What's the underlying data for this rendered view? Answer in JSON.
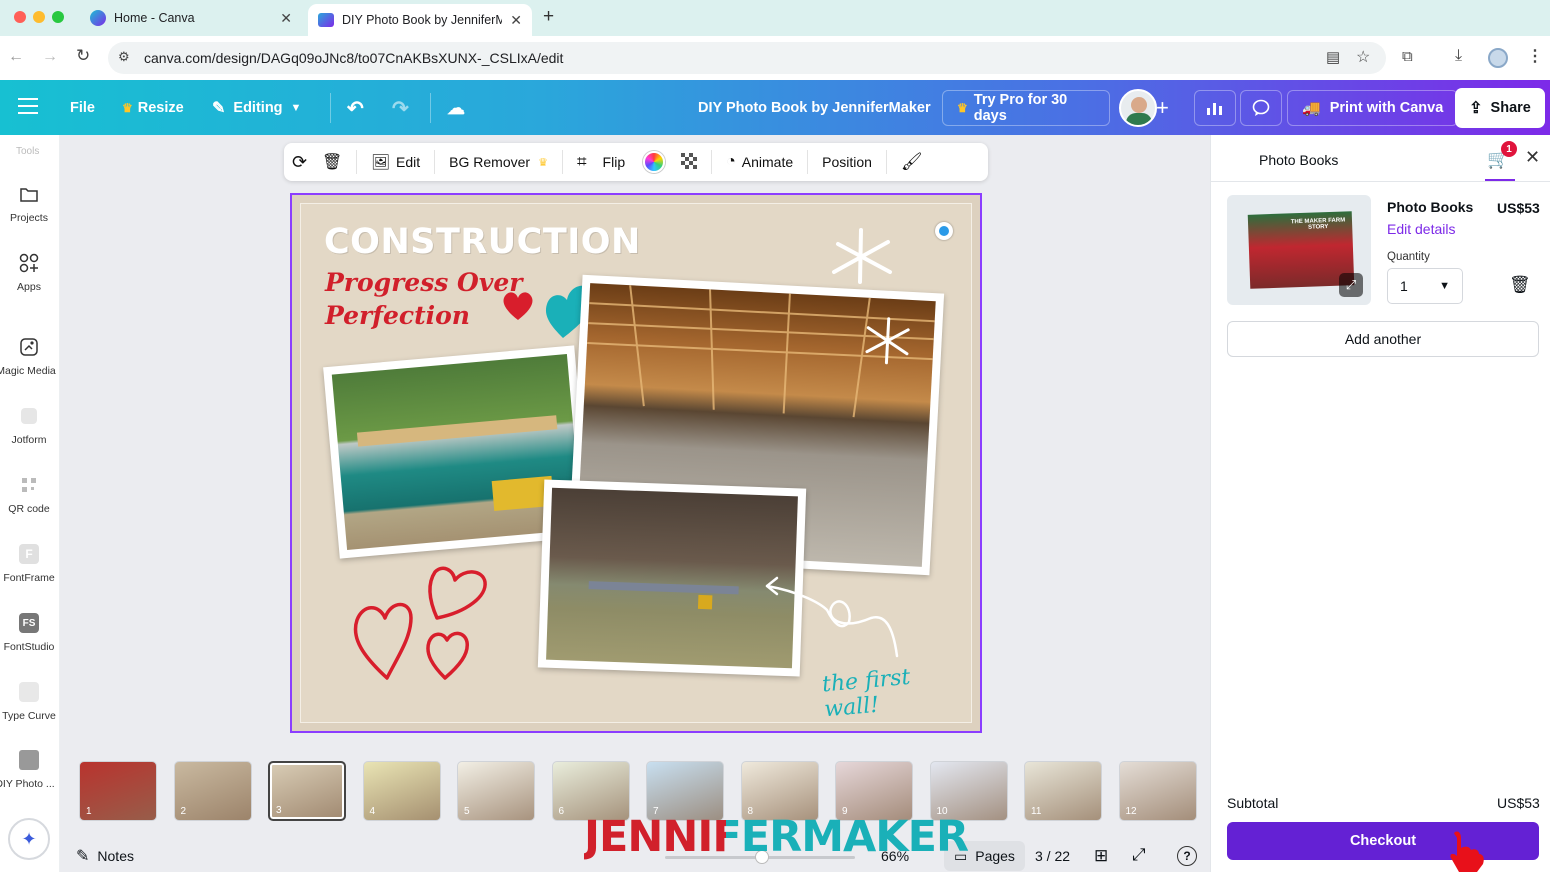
{
  "browser": {
    "tabs": [
      {
        "title": "Home - Canva"
      },
      {
        "title": "DIY Photo Book by JenniferM"
      }
    ],
    "new_tab_icon": "plus-icon",
    "url": "canva.com/design/DAGq09oJNc8/to07CnAKBsXUNX-_CSLIxA/edit"
  },
  "header": {
    "menu_icon": "hamburger-icon",
    "file_label": "File",
    "resize_label": "Resize",
    "editing_label": "Editing",
    "design_title": "DIY Photo Book by JenniferMaker",
    "try_pro_label": "Try Pro for 30 days",
    "print_label": "Print with Canva",
    "share_label": "Share"
  },
  "sidebar": {
    "partial_label": "Tools",
    "items": [
      {
        "label": "Projects",
        "icon": "folder-icon"
      },
      {
        "label": "Apps",
        "icon": "apps-grid-icon"
      },
      {
        "label": "Magic Media",
        "icon": "magic-media-icon"
      },
      {
        "label": "Jotform",
        "icon": "jotform-icon"
      },
      {
        "label": "QR code",
        "icon": "qr-code-icon"
      },
      {
        "label": "FontFrame",
        "icon": "fontframe-icon"
      },
      {
        "label": "FontStudio",
        "icon": "fontstudio-icon"
      },
      {
        "label": "Type Curve",
        "icon": "type-curve-icon"
      },
      {
        "label": "DIY Photo ...",
        "icon": "photo-app-icon"
      }
    ]
  },
  "toolbar": {
    "edit_label": "Edit",
    "bg_remover_label": "BG Remover",
    "flip_label": "Flip",
    "animate_label": "Animate",
    "position_label": "Position"
  },
  "canvas": {
    "title": "CONSTRUCTION",
    "subtitle_line1": "Progress Over",
    "subtitle_line2": "Perfection",
    "caption": "the first wall!"
  },
  "thumbnails": {
    "pages": [
      "1",
      "2",
      "3",
      "4",
      "5",
      "6",
      "7",
      "8",
      "9",
      "10",
      "11",
      "12"
    ],
    "active_page": "3",
    "colors": [
      "#b9332e",
      "#c9b9a0",
      "#d9cdb6",
      "#e9e4b4",
      "#f2efe5",
      "#e9eddc",
      "#c8dff0",
      "#efe9dc",
      "#e6d7d9",
      "#e3e7f0",
      "#e8e5d8",
      "#e4ddd6"
    ]
  },
  "bottombar": {
    "notes_label": "Notes",
    "zoom": "66%",
    "pages_label": "Pages",
    "page_count": "3 / 22",
    "help_label": "?"
  },
  "watermark": "JENNIFERMAKER",
  "cart": {
    "panel_title": "Photo Books",
    "cart_badge": "1",
    "product_name": "Photo Books",
    "price": "US$53",
    "edit_details": "Edit details",
    "quantity_label": "Quantity",
    "quantity_value": "1",
    "add_another": "Add another",
    "subtotal_label": "Subtotal",
    "subtotal_value": "US$53",
    "checkout_label": "Checkout",
    "product_cover_text": "THE MAKER FARM STORY"
  },
  "colors": {
    "accent_purple": "#7d2ae8",
    "canvas_title_red": "#d1202b",
    "caption_teal": "#1ab0b8"
  }
}
